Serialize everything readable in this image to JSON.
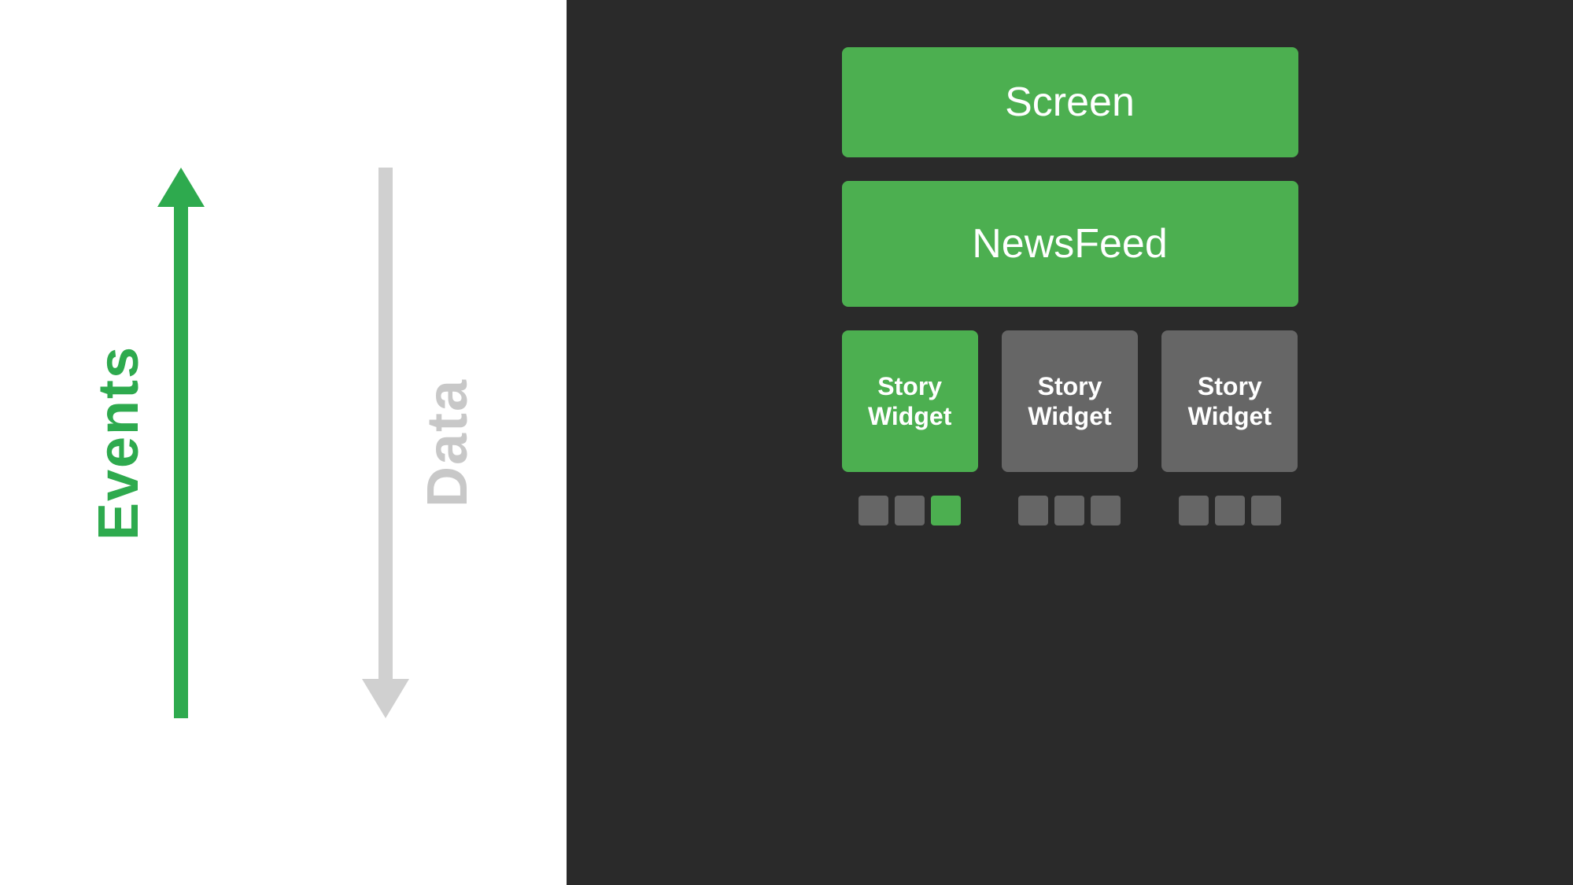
{
  "left": {
    "events_label": "Events",
    "data_label": "Data"
  },
  "right": {
    "screen_label": "Screen",
    "newsfeed_label": "NewsFeed",
    "story_widgets": [
      {
        "label": "Story\nWidget",
        "color": "green"
      },
      {
        "label": "Story\nWidget",
        "color": "gray"
      },
      {
        "label": "Story\nWidget",
        "color": "gray"
      }
    ],
    "dots_groups": [
      [
        {
          "color": "gray"
        },
        {
          "color": "gray"
        },
        {
          "color": "green"
        }
      ],
      [
        {
          "color": "gray"
        },
        {
          "color": "gray"
        },
        {
          "color": "gray"
        }
      ],
      [
        {
          "color": "gray"
        },
        {
          "color": "gray"
        },
        {
          "color": "gray"
        }
      ]
    ]
  },
  "colors": {
    "green": "#4caf50",
    "gray": "#666666",
    "dark_bg": "#2a2a2a",
    "white_bg": "#ffffff"
  }
}
